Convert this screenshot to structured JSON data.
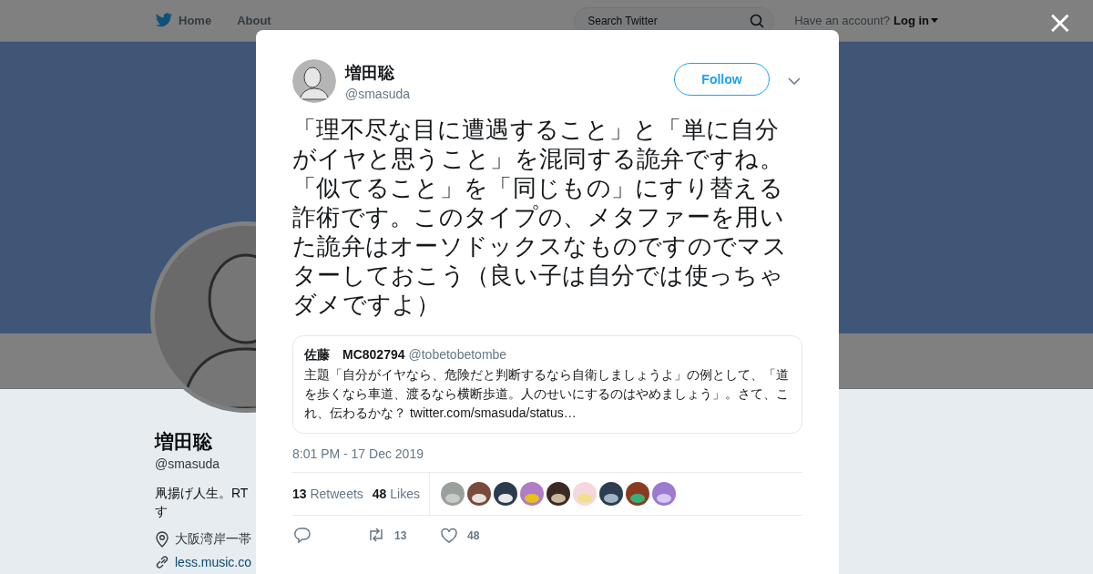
{
  "header": {
    "nav": [
      {
        "label": "Home",
        "kind": "home"
      },
      {
        "label": "About",
        "kind": "plain"
      }
    ],
    "search": {
      "placeholder": "Search Twitter"
    },
    "account_prompt": "Have an account?",
    "login": "Log in"
  },
  "profile": {
    "name": "増田聡",
    "handle": "@smasuda",
    "bio": [
      "凧揚げ人生。RT",
      "す"
    ],
    "location": "大阪湾岸一帯",
    "link": "less.music.co"
  },
  "close": "×",
  "modal": {
    "author": {
      "name": "増田聡",
      "handle": "@smasuda"
    },
    "follow_button": "Follow",
    "text": "「理不尽な目に遭遇すること」と「単に自分がイヤと思うこと」を混同する詭弁ですね。「似てること」を「同じもの」にすり替える詐術です。このタイプの、メタファーを用いた詭弁はオーソドックスなものですのでマスターしておこう（良い子は自分では使っちゃダメですよ）",
    "quoted": {
      "name": "佐藤　MC802794",
      "handle": "@tobetobetombe",
      "text": "主題「自分がイヤなら、危険だと判断するなら自衛しましょうよ」の例として、「道を歩くなら車道、渡るなら横断歩道。人のせいにするのはやめましょう」。さて、これ、伝わるかな？ twitter.com/smasuda/status…"
    },
    "time": "8:01 PM - 17 Dec 2019",
    "stats": [
      {
        "count": "13",
        "label": "Retweets"
      },
      {
        "count": "48",
        "label": "Likes"
      }
    ],
    "actions": [
      {
        "kind": "reply"
      },
      {
        "kind": "retweet",
        "count": "13"
      },
      {
        "kind": "like",
        "count": "48"
      }
    ]
  }
}
